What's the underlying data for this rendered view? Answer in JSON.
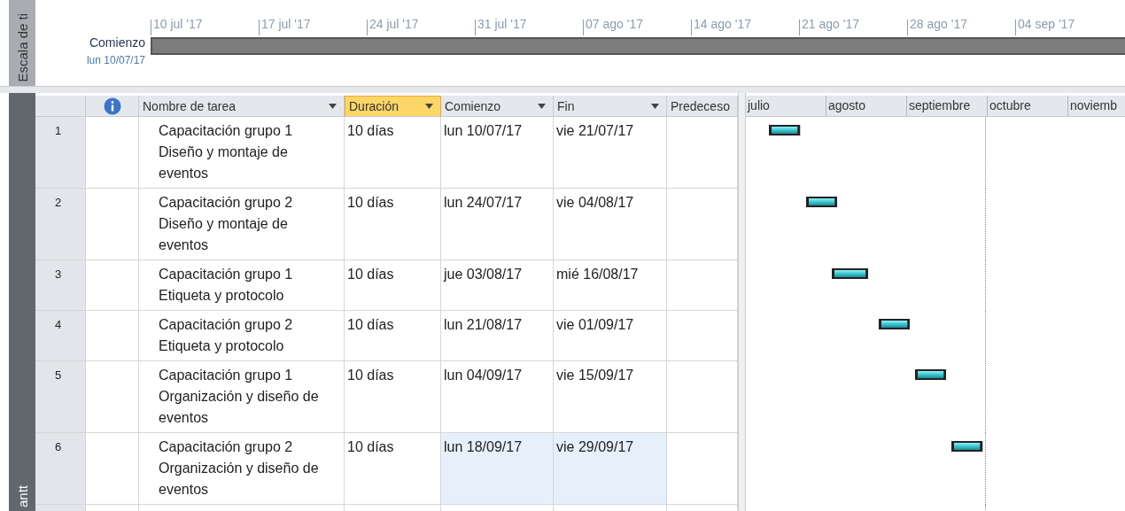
{
  "timescale": {
    "side_label": "Escala de ti",
    "start_label": "Comienzo",
    "start_date": "lun 10/07/17",
    "ticks": [
      "10 jul '17",
      "17 jul '17",
      "24 jul '17",
      "31 jul '17",
      "07 ago '17",
      "14 ago '17",
      "21 ago '17",
      "28 ago '17",
      "04 sep '17"
    ]
  },
  "view_label": "antt",
  "table": {
    "columns": [
      {
        "kind": "info",
        "selected": false
      },
      {
        "kind": "text",
        "label": "Nombre de tarea",
        "selected": false
      },
      {
        "kind": "text",
        "label": "Duración",
        "selected": true
      },
      {
        "kind": "text",
        "label": "Comienzo",
        "selected": false
      },
      {
        "kind": "text",
        "label": "Fin",
        "selected": false
      },
      {
        "kind": "plain",
        "label": "Predeceso",
        "selected": false
      }
    ],
    "rows": [
      {
        "id": "1",
        "name": "Capacitación grupo 1 Diseño y montaje de eventos",
        "duration": "10 días",
        "start": "lun 10/07/17",
        "finish": "vie 21/07/17",
        "selected": false
      },
      {
        "id": "2",
        "name": "Capacitación grupo 2 Diseño y montaje de eventos",
        "duration": "10 días",
        "start": "lun 24/07/17",
        "finish": "vie 04/08/17",
        "selected": false
      },
      {
        "id": "3",
        "name": "Capacitación grupo 1 Etiqueta y protocolo",
        "duration": "10 días",
        "start": "jue 03/08/17",
        "finish": "mié 16/08/17",
        "selected": false
      },
      {
        "id": "4",
        "name": "Capacitación grupo 2 Etiqueta y protocolo",
        "duration": "10 días",
        "start": "lun 21/08/17",
        "finish": "vie 01/09/17",
        "selected": false
      },
      {
        "id": "5",
        "name": "Capacitación grupo 1 Organización y diseño de eventos",
        "duration": "10 días",
        "start": "lun 04/09/17",
        "finish": "vie 15/09/17",
        "selected": false
      },
      {
        "id": "6",
        "name": "Capacitación grupo 2 Organización y diseño de eventos",
        "duration": "10 días",
        "start": "lun 18/09/17",
        "finish": "vie 29/09/17",
        "selected": true
      }
    ]
  },
  "gantt": {
    "months": [
      "julio",
      "agosto",
      "septiembre",
      "octubre",
      "noviemb"
    ]
  }
}
